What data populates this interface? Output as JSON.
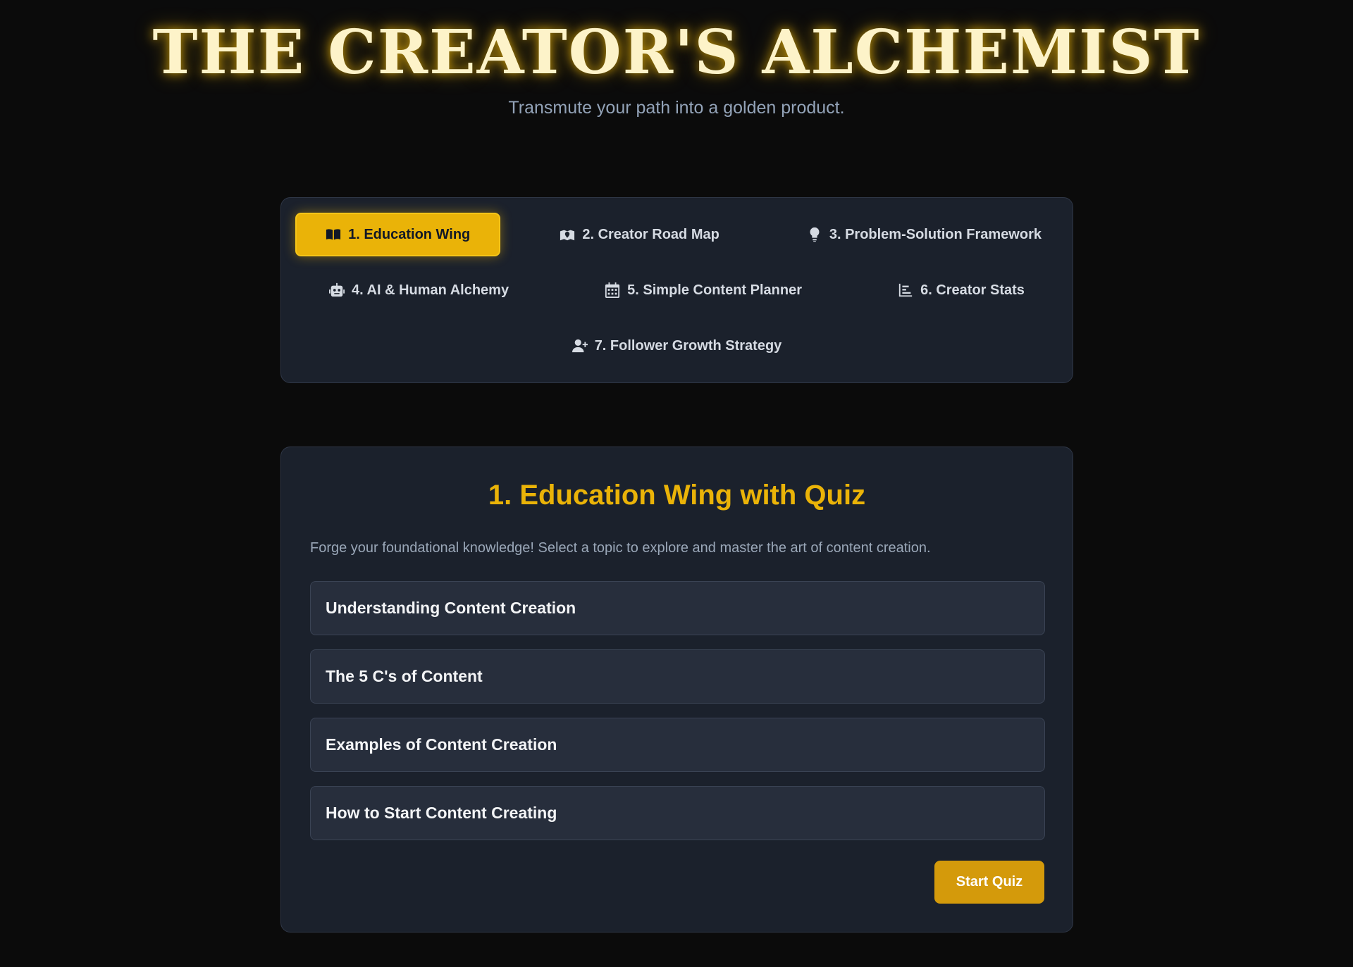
{
  "header": {
    "title": "THE CREATOR'S ALCHEMIST",
    "subtitle": "Transmute your path into a golden product."
  },
  "nav": {
    "tabs": [
      {
        "label": "1. Education Wing",
        "icon": "book-open-icon",
        "active": true
      },
      {
        "label": "2. Creator Road Map",
        "icon": "map-location-icon",
        "active": false
      },
      {
        "label": "3. Problem-Solution Framework",
        "icon": "lightbulb-icon",
        "active": false
      },
      {
        "label": "4. AI & Human Alchemy",
        "icon": "robot-icon",
        "active": false
      },
      {
        "label": "5. Simple Content Planner",
        "icon": "calendar-icon",
        "active": false
      },
      {
        "label": "6. Creator Stats",
        "icon": "bar-chart-icon",
        "active": false
      },
      {
        "label": "7. Follower Growth Strategy",
        "icon": "user-plus-icon",
        "active": false
      }
    ]
  },
  "main": {
    "title": "1. Education Wing with Quiz",
    "description": "Forge your foundational knowledge! Select a topic to explore and master the art of content creation.",
    "topics": [
      "Understanding Content Creation",
      "The 5 C's of Content",
      "Examples of Content Creation",
      "How to Start Content Creating"
    ],
    "start_quiz_label": "Start Quiz"
  },
  "colors": {
    "background": "#0b0b0b",
    "card": "#1b212c",
    "accent": "#eab308",
    "quiz_button": "#d49a0b"
  }
}
